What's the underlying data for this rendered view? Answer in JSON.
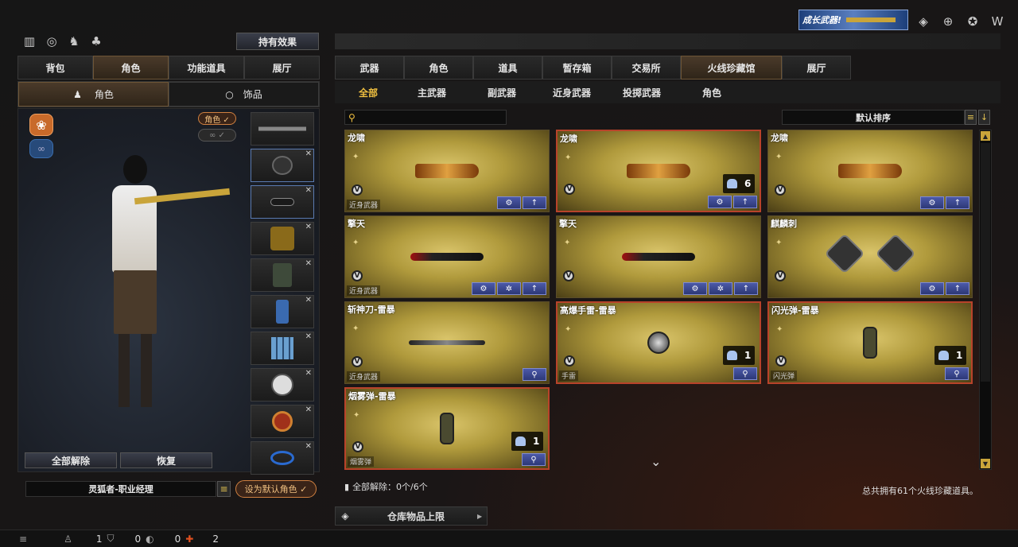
{
  "top_right": {
    "banner": "成长武器!"
  },
  "left_panel": {
    "holding_effects": "持有效果",
    "tabs": [
      {
        "label": "背包"
      },
      {
        "label": "角色",
        "active": true
      },
      {
        "label": "功能道具"
      },
      {
        "label": "展厅"
      }
    ],
    "subtabs": [
      {
        "label": "角色",
        "active": true
      },
      {
        "label": "饰品"
      }
    ],
    "role_tag": "角色 ✓",
    "release_all": "全部解除",
    "restore": "恢复",
    "character_name": "灵狐者-职业经理",
    "set_default": "设为默认角色 ✓"
  },
  "main_panel": {
    "tabs": [
      {
        "label": "武器"
      },
      {
        "label": "角色"
      },
      {
        "label": "道具"
      },
      {
        "label": "暂存箱"
      },
      {
        "label": "交易所"
      },
      {
        "label": "火线珍藏馆",
        "active": true
      },
      {
        "label": "展厅"
      }
    ],
    "subtabs": [
      {
        "label": "全部",
        "active": true
      },
      {
        "label": "主武器"
      },
      {
        "label": "副武器"
      },
      {
        "label": "近身武器"
      },
      {
        "label": "投掷武器"
      },
      {
        "label": "角色"
      }
    ],
    "search_placeholder": "",
    "sort_label": "默认排序",
    "items": [
      {
        "name": "龙啸",
        "category": "近身武器",
        "qty": ""
      },
      {
        "name": "龙啸",
        "category": "",
        "qty": "6"
      },
      {
        "name": "龙啸",
        "category": "",
        "qty": ""
      },
      {
        "name": "擎天",
        "category": "近身武器",
        "qty": ""
      },
      {
        "name": "擎天",
        "category": "",
        "qty": ""
      },
      {
        "name": "麒麟刺",
        "category": "",
        "qty": ""
      },
      {
        "name": "斩神刀-雷暴",
        "category": "近身武器",
        "qty": ""
      },
      {
        "name": "高爆手雷-雷暴",
        "category": "手雷",
        "qty": "1"
      },
      {
        "name": "闪光弹-雷暴",
        "category": "闪光弹",
        "qty": "1"
      },
      {
        "name": "烟雾弹-雷暴",
        "category": "烟雾弹",
        "qty": "1"
      }
    ],
    "footer_left": "全部解除：0个/6个",
    "footer_right": "总共拥有61个火线珍藏道具。",
    "warehouse_limit": "仓库物品上限"
  },
  "bottom_bar": {
    "count1": "1",
    "count2": "0",
    "count3": "0",
    "count4": "2"
  }
}
